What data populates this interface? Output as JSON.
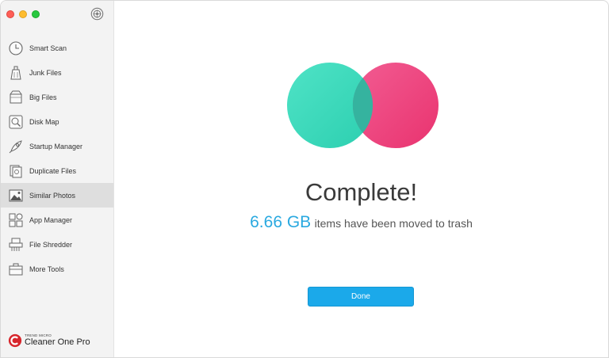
{
  "window": {
    "traffic_lights": [
      "close",
      "minimize",
      "zoom"
    ],
    "header_icon": "globe-icon"
  },
  "sidebar": {
    "items": [
      {
        "label": "Smart Scan",
        "icon": "clock-icon",
        "active": false
      },
      {
        "label": "Junk Files",
        "icon": "trash-icon",
        "active": false
      },
      {
        "label": "Big Files",
        "icon": "box-icon",
        "active": false
      },
      {
        "label": "Disk Map",
        "icon": "magnifier-icon",
        "active": false
      },
      {
        "label": "Startup Manager",
        "icon": "rocket-icon",
        "active": false
      },
      {
        "label": "Duplicate Files",
        "icon": "duplicate-icon",
        "active": false
      },
      {
        "label": "Similar Photos",
        "icon": "photo-icon",
        "active": true
      },
      {
        "label": "App Manager",
        "icon": "apps-icon",
        "active": false
      },
      {
        "label": "File Shredder",
        "icon": "shredder-icon",
        "active": false
      },
      {
        "label": "More Tools",
        "icon": "toolbox-icon",
        "active": false
      }
    ],
    "brand": {
      "vendor": "TREND MICRO",
      "product": "Cleaner One",
      "edition": "Pro"
    }
  },
  "main": {
    "title": "Complete!",
    "amount": "6.66 GB",
    "message": "items have been moved to trash",
    "done_label": "Done"
  },
  "colors": {
    "accent": "#1ba9ea",
    "circle_left": "#3fdcc0",
    "circle_right": "#ee3f7c"
  }
}
